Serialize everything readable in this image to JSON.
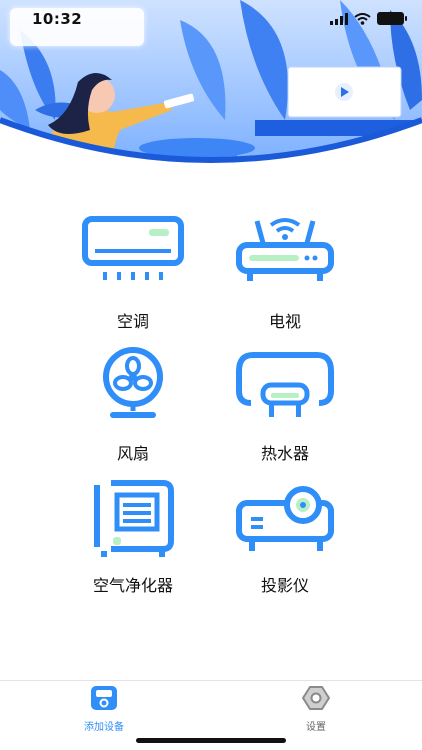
{
  "status_bar": {
    "time": "10:32"
  },
  "devices": [
    {
      "name": "空调",
      "icon": "air-conditioner-icon"
    },
    {
      "name": "电视",
      "icon": "tv-router-icon"
    },
    {
      "name": "风扇",
      "icon": "fan-icon"
    },
    {
      "name": "热水器",
      "icon": "water-heater-icon"
    },
    {
      "name": "空气净化器",
      "icon": "air-purifier-icon"
    },
    {
      "name": "投影仪",
      "icon": "projector-icon"
    }
  ],
  "tabbar": {
    "tabs": [
      {
        "label": "添加设备",
        "icon": "remote-device-icon",
        "active": true
      },
      {
        "label": "设置",
        "icon": "gear-icon",
        "active": false
      }
    ]
  },
  "colors": {
    "primary": "#2f8ef7",
    "accent_green": "#b7f0c4",
    "hero_blue": "#1e6be0"
  }
}
